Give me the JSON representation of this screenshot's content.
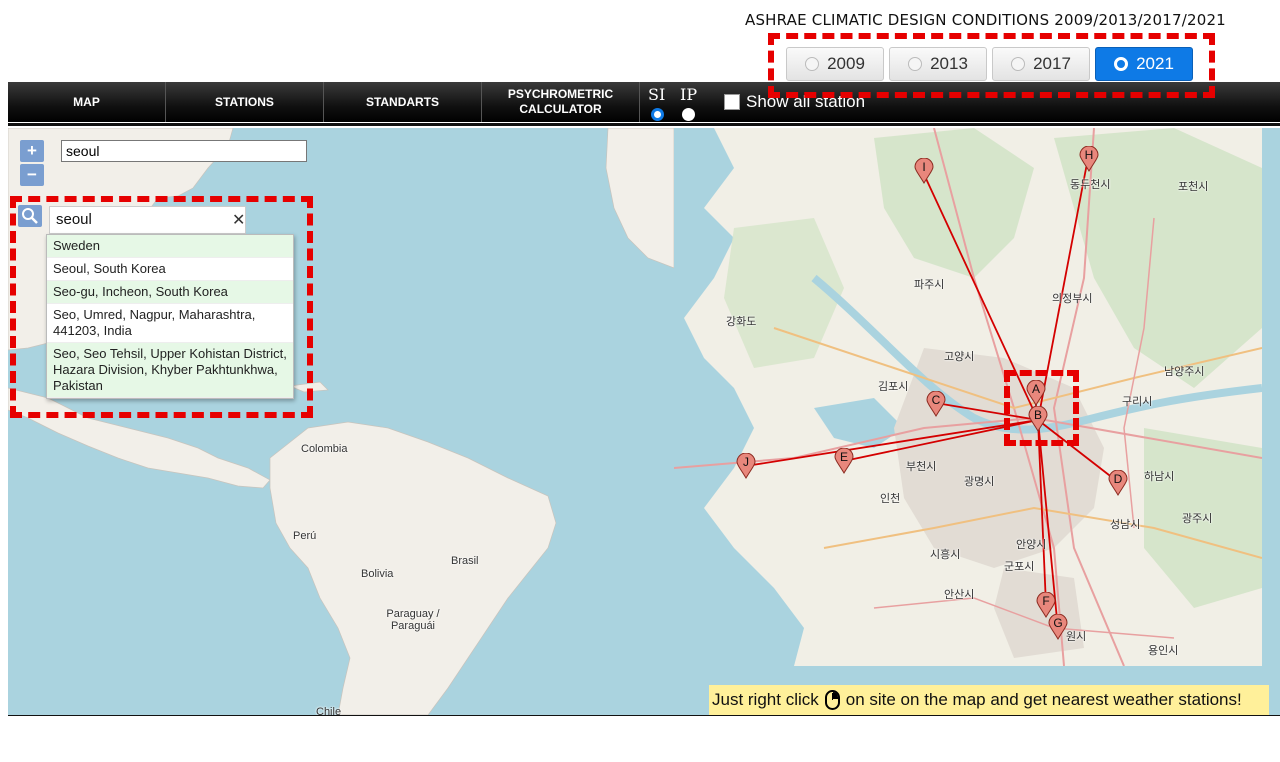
{
  "header": {
    "title": "ASHRAE CLIMATIC DESIGN CONDITIONS 2009/2013/2017/2021"
  },
  "years": [
    {
      "label": "2009",
      "selected": false
    },
    {
      "label": "2013",
      "selected": false
    },
    {
      "label": "2017",
      "selected": false
    },
    {
      "label": "2021",
      "selected": true
    }
  ],
  "nav": {
    "items": [
      "MAP",
      "STATIONS",
      "STANDARTS",
      "PSYCHROMETRIC CALCULATOR"
    ],
    "unit_si": "SI",
    "unit_ip": "IP",
    "selected_unit": "SI",
    "show_all_label": "Show all station",
    "show_all_checked": false
  },
  "map": {
    "zoom_in": "+",
    "zoom_out": "−",
    "search_value": "seoul",
    "geocoder": {
      "value": "seoul",
      "clear": "✕",
      "results": [
        "Sweden",
        "Seoul, South Korea",
        "Seo-gu, Incheon, South Korea",
        "Seo, Umred, Nagpur, Maharashtra, 441203, India",
        "Seo, Seo Tehsil, Upper Kohistan District, Hazara Division, Khyber Pakhtunkhwa, Pakistan"
      ]
    },
    "country_labels": [
      "Colombia",
      "Perú",
      "Brasil",
      "Bolivia",
      "Paraguay / Paraguái",
      "Chile"
    ],
    "inset": {
      "markers": [
        "A",
        "B",
        "C",
        "D",
        "E",
        "F",
        "G",
        "H",
        "I",
        "J"
      ],
      "place_labels": [
        "파주시",
        "고양시",
        "김포시",
        "부천시",
        "인천",
        "광명시",
        "안양시",
        "군포시",
        "안산시",
        "의정부시",
        "남양주시",
        "구리시",
        "성남시",
        "광주시",
        "하남시",
        "시흥시",
        "용인시",
        "포천시",
        "동두천시",
        "강화도",
        "원시"
      ]
    },
    "hint": {
      "before": "Just right click",
      "after": "on site on the map and get nearest weather stations!"
    }
  },
  "colors": {
    "accent": "#0e7ae6",
    "highlight": "#e60000",
    "marker": "#e8877c",
    "route": "#d40000",
    "hint_bg": "#fff09a",
    "water": "#aad3df"
  }
}
